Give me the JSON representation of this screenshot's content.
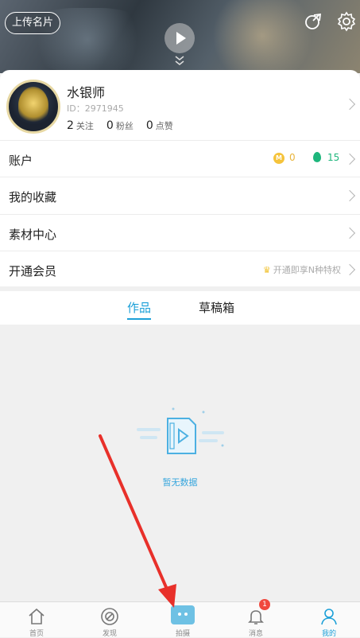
{
  "header": {
    "upload_label": "上传名片"
  },
  "profile": {
    "username": "水银师",
    "user_id": "ID：2971945",
    "following_count": "2",
    "following_label": "关注",
    "fans_count": "0",
    "fans_label": "粉丝",
    "likes_count": "0",
    "likes_label": "点赞"
  },
  "menu": {
    "account_label": "账户",
    "coin_value": "0",
    "drop_value": "15",
    "favorites_label": "我的收藏",
    "materials_label": "素材中心",
    "vip_label": "开通会员",
    "vip_promo": "开通即享N种特权"
  },
  "tabs": {
    "works_label": "作品",
    "drafts_label": "草稿箱"
  },
  "empty_state": {
    "text": "暂无数据"
  },
  "navbar": {
    "items": [
      {
        "label": "首页",
        "icon": "home-icon"
      },
      {
        "label": "发现",
        "icon": "discover-icon"
      },
      {
        "label": "拍摄",
        "icon": "camera-icon"
      },
      {
        "label": "消息",
        "icon": "bell-icon",
        "badge": "1"
      },
      {
        "label": "我的",
        "icon": "user-icon"
      }
    ]
  },
  "colors": {
    "accent": "#1ca0d8",
    "coin": "#f5c33b",
    "drop": "#1eb67c",
    "badge": "#f0483e",
    "arrow": "#e8302a"
  }
}
